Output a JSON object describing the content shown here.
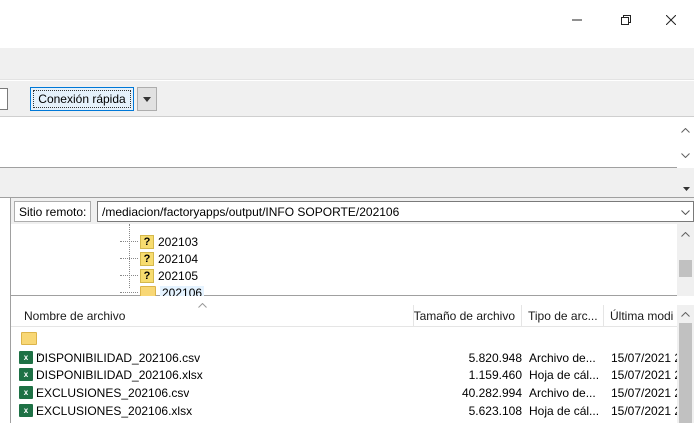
{
  "window": {
    "controls": [
      "minimize",
      "restore",
      "close"
    ]
  },
  "quickconnect": {
    "button_label": "Conexión rápida"
  },
  "remote": {
    "site_label": "Sitio remoto:",
    "path": "/mediacion/factoryapps/output/INFO SOPORTE/202106",
    "tree": [
      {
        "name": "202103",
        "icon": "question-folder-icon"
      },
      {
        "name": "202104",
        "icon": "question-folder-icon"
      },
      {
        "name": "202105",
        "icon": "question-folder-icon"
      },
      {
        "name": "202106",
        "icon": "folder-icon",
        "selected": true
      }
    ]
  },
  "filelist": {
    "columns": [
      "Nombre de archivo",
      "Tamaño de archivo",
      "Tipo de arc...",
      "Última modi"
    ],
    "rows": [
      {
        "name": "..",
        "size": "",
        "type": "",
        "modified": "",
        "icon": "folder-icon"
      },
      {
        "name": "DISPONIBILIDAD_202106.csv",
        "size": "5.820.948",
        "type": "Archivo de...",
        "modified": "15/07/2021 2",
        "icon": "excel-icon"
      },
      {
        "name": "DISPONIBILIDAD_202106.xlsx",
        "size": "1.159.460",
        "type": "Hoja de cál...",
        "modified": "15/07/2021 2",
        "icon": "excel-icon"
      },
      {
        "name": "EXCLUSIONES_202106.csv",
        "size": "40.282.994",
        "type": "Archivo de...",
        "modified": "15/07/2021 2",
        "icon": "excel-icon"
      },
      {
        "name": "EXCLUSIONES_202106.xlsx",
        "size": "5.623.108",
        "type": "Hoja de cál...",
        "modified": "15/07/2021 2",
        "icon": "excel-icon"
      }
    ]
  },
  "colors": {
    "accent": "#0078d7",
    "excel": "#1e7145",
    "folder": "#f8d775",
    "chrome": "#f0f0f0"
  }
}
